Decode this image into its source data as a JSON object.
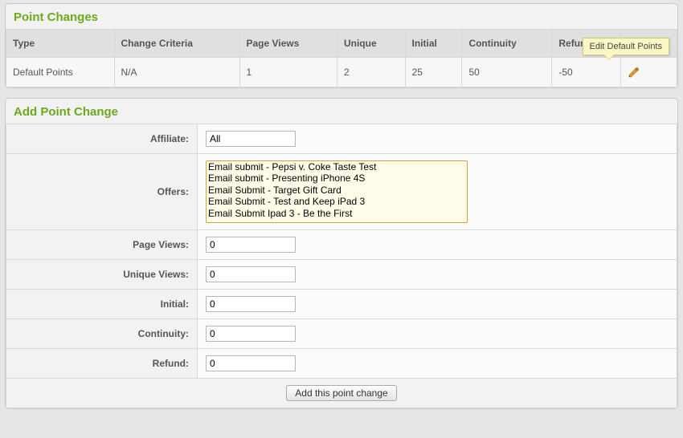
{
  "point_changes": {
    "title": "Point Changes",
    "headers": {
      "type": "Type",
      "criteria": "Change Criteria",
      "page_views": "Page Views",
      "unique": "Unique",
      "initial": "Initial",
      "continuity": "Continuity",
      "refund": "Refund"
    },
    "row": {
      "type": "Default Points",
      "criteria": "N/A",
      "page_views": "1",
      "unique": "2",
      "initial": "25",
      "continuity": "50",
      "refund": "-50"
    },
    "tooltip": "Edit Default Points"
  },
  "add_form": {
    "title": "Add Point Change",
    "labels": {
      "affiliate": "Affiliate:",
      "offers": "Offers:",
      "page_views": "Page Views:",
      "unique_views": "Unique Views:",
      "initial": "Initial:",
      "continuity": "Continuity:",
      "refund": "Refund:"
    },
    "values": {
      "affiliate": "All",
      "page_views": "0",
      "unique_views": "0",
      "initial": "0",
      "continuity": "0",
      "refund": "0"
    },
    "offers": [
      "Email submit - Pepsi v. Coke Taste Test",
      "Email submit - Presenting iPhone 4S",
      "Email Submit - Target Gift Card",
      "Email Submit - Test and Keep iPad 3",
      "Email Submit Ipad 3 - Be the First"
    ],
    "submit_label": "Add this point change"
  }
}
